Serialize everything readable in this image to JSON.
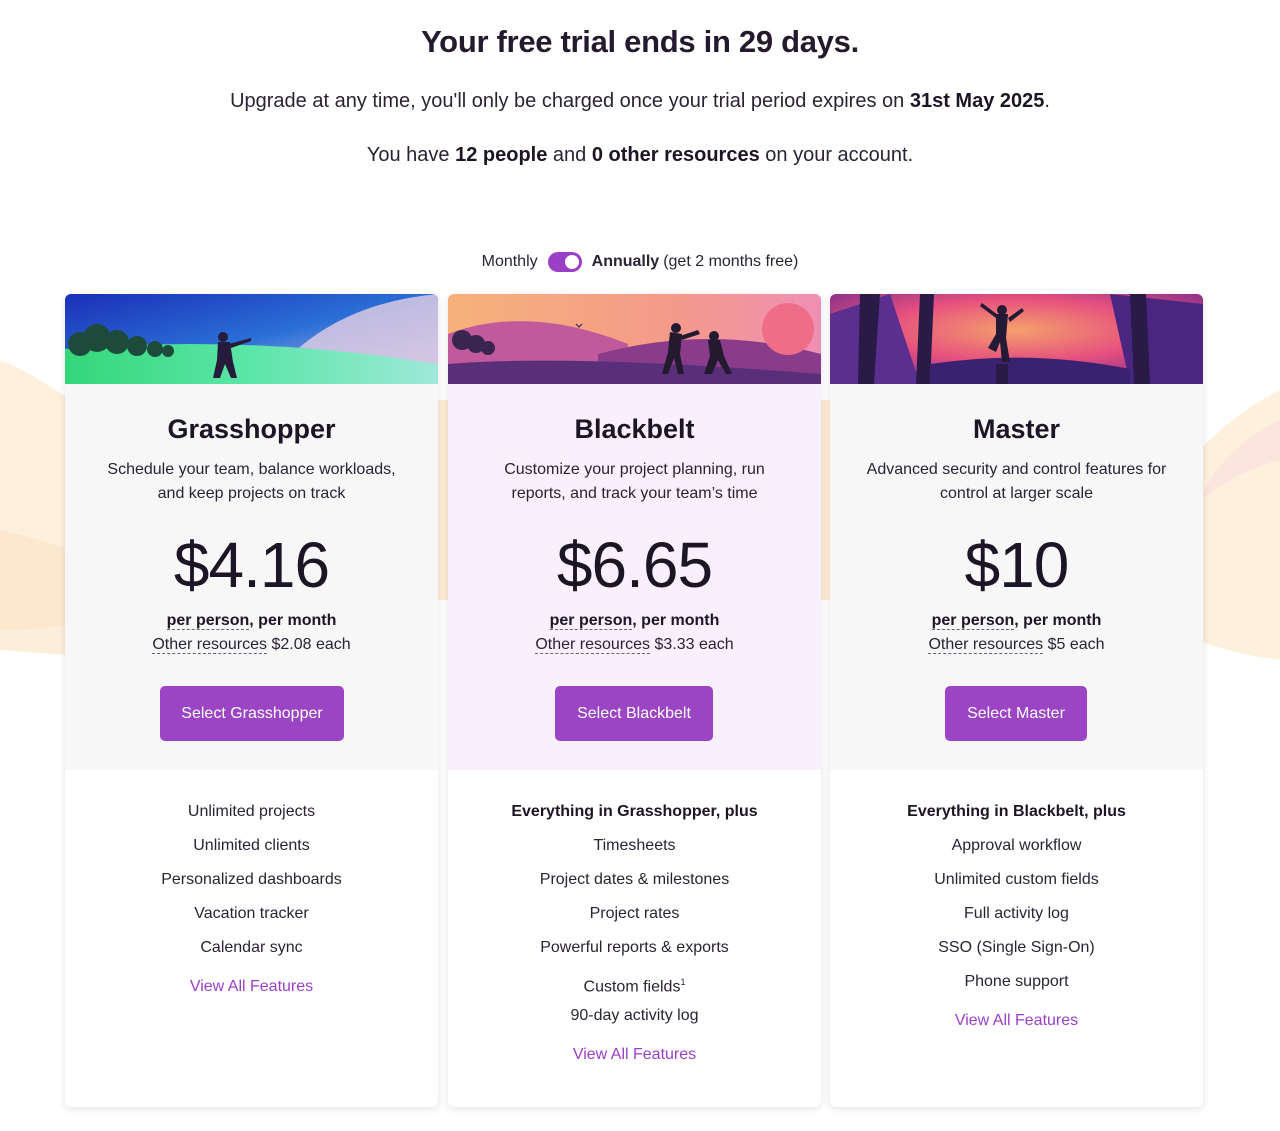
{
  "header": {
    "trial_title": "Your free trial ends in 29 days.",
    "trial_sub_prefix": "Upgrade at any time, you'll only be charged once your trial period expires on",
    "trial_end_date": "31st May 2025",
    "account_prefix": "You have",
    "people_count": "12 people",
    "account_and": "and",
    "resources_count": "0 other resources",
    "account_suffix": "on your account."
  },
  "billing": {
    "monthly_label": "Monthly",
    "annually_label": "Annually",
    "annually_note": "(get 2 months free)",
    "annual_selected": true
  },
  "colors": {
    "accent": "#9b44c4",
    "highlight_card_bg": "#f9f0fd"
  },
  "plans": [
    {
      "name": "Grasshopper",
      "description": "Schedule your team, balance workloads, and keep projects on track",
      "price": "$4.16",
      "per_person_label": "per person",
      "per_month_label": ", per month",
      "other_resources_label": "Other resources",
      "other_resources_price": "$2.08 each",
      "select_label": "Select Grasshopper",
      "features_lead": "",
      "features": [
        "Unlimited projects",
        "Unlimited clients",
        "Personalized dashboards",
        "Vacation tracker",
        "Calendar sync"
      ],
      "view_all_label": "View All Features"
    },
    {
      "name": "Blackbelt",
      "description": "Customize your project planning, run reports, and track your team’s time",
      "price": "$6.65",
      "per_person_label": "per person",
      "per_month_label": ", per month",
      "other_resources_label": "Other resources",
      "other_resources_price": "$3.33 each",
      "select_label": "Select Blackbelt",
      "features_lead": "Everything in Grasshopper, plus",
      "features": [
        "Timesheets",
        "Project dates & milestones",
        "Project rates",
        "Powerful reports & exports",
        "Custom fields",
        "90-day activity log"
      ],
      "custom_fields_footnote": "1",
      "view_all_label": "View All Features"
    },
    {
      "name": "Master",
      "description": "Advanced security and control features for control at larger scale",
      "price": "$10",
      "per_person_label": "per person",
      "per_month_label": ", per month",
      "other_resources_label": "Other resources",
      "other_resources_price": "$5 each",
      "select_label": "Select Master",
      "features_lead": "Everything in Blackbelt, plus",
      "features": [
        "Approval workflow",
        "Unlimited custom fields",
        "Full activity log",
        "SSO (Single Sign-On)",
        "Phone support"
      ],
      "view_all_label": "View All Features"
    }
  ]
}
